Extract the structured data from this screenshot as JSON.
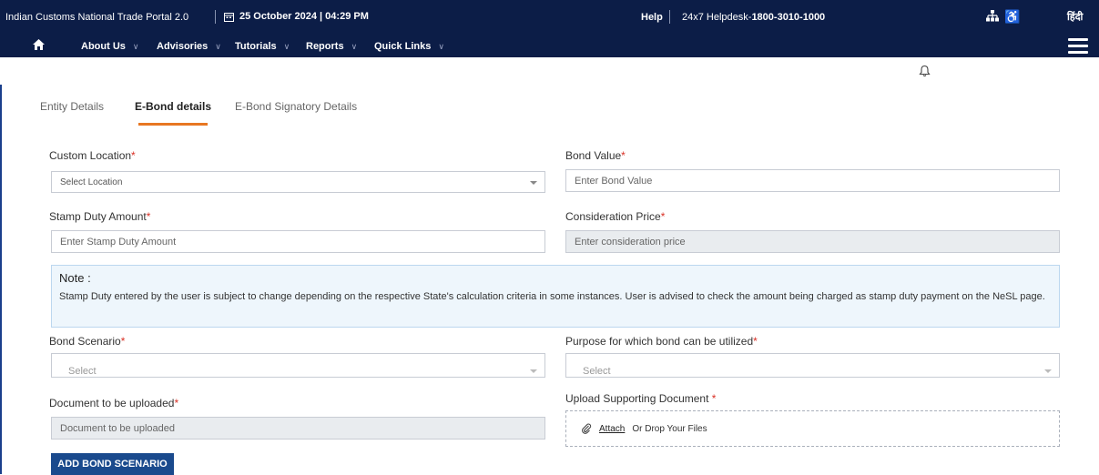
{
  "topbar": {
    "portal_title": "Indian Customs National Trade Portal 2.0",
    "date_time": "25 October 2024 | 04:29 PM",
    "help_label": "Help",
    "helpdesk_prefix": "24x7 Helpdesk-",
    "helpdesk_number": "1800-3010-1000",
    "hindi_label": "हिंदी"
  },
  "nav": {
    "items": [
      {
        "label": "About Us"
      },
      {
        "label": "Advisories"
      },
      {
        "label": "Tutorials"
      },
      {
        "label": "Reports"
      },
      {
        "label": "Quick Links"
      }
    ]
  },
  "tabs": [
    {
      "label": "Entity Details",
      "active": false
    },
    {
      "label": "E-Bond details",
      "active": true
    },
    {
      "label": "E-Bond Signatory Details",
      "active": false
    }
  ],
  "form": {
    "custom_location": {
      "label": "Custom Location",
      "placeholder": "Select Location"
    },
    "bond_value": {
      "label": "Bond Value",
      "placeholder": "Enter Bond Value"
    },
    "stamp_duty": {
      "label": "Stamp Duty Amount",
      "placeholder": "Enter Stamp Duty Amount"
    },
    "consideration_price": {
      "label": "Consideration Price",
      "placeholder": "Enter consideration price"
    },
    "bond_scenario": {
      "label": "Bond Scenario",
      "placeholder": "Select"
    },
    "purpose": {
      "label": "Purpose for which bond can be utilized",
      "placeholder": "Select"
    },
    "document": {
      "label": "Document to be uploaded",
      "placeholder": "Document to be uploaded"
    },
    "upload_support": {
      "label": "Upload Supporting Document ",
      "attach_label": "Attach",
      "drop_label": "Or Drop Your Files"
    },
    "required_mark": "*"
  },
  "note": {
    "title": "Note :",
    "text": "Stamp Duty entered by the user is subject to change depending on the respective State's calculation criteria in some instances. User is advised to check the amount being charged as stamp duty payment on the NeSL page."
  },
  "actions": {
    "add_bond_scenario": "ADD BOND SCENARIO"
  },
  "colors": {
    "header_bg": "#0c1d47",
    "tab_accent": "#e87722",
    "button_bg": "#1a4a8d",
    "required": "#d93025",
    "note_bg": "#eef6fc"
  },
  "icons": [
    "calendar-icon",
    "sitemap-icon",
    "accessibility-icon",
    "home-icon",
    "hamburger-menu-icon",
    "bell-icon",
    "paperclip-icon"
  ]
}
